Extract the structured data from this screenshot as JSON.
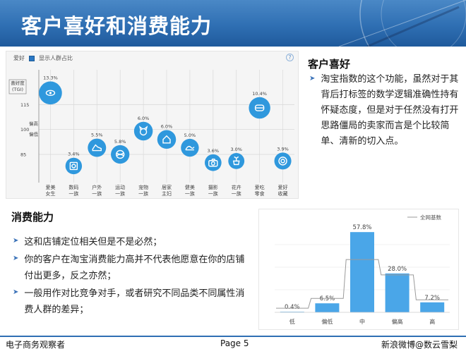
{
  "slide": {
    "title": "客户喜好和消费能力",
    "footer_left": "电子商务观察者",
    "footer_page": "Page 5",
    "footer_right": "新浪微博@数云雪梨"
  },
  "preference": {
    "heading": "客户喜好",
    "paragraph": "淘宝指数的这个功能，虽然对于其背后打标签的数学逻辑准确性持有怀疑态度，但是对于任然没有打开思路僵局的卖家而言是个比较简单、清新的切入点。"
  },
  "spending": {
    "heading": "消费能力",
    "points": [
      "这和店铺定位相关但是不是必然；",
      "你的客户在淘宝消费能力高并不代表他愿意在你的店铺付出更多，反之亦然；",
      "一般用作对比竞争对手，或者研究不同品类不同属性消费人群的差异；"
    ]
  },
  "chart_data": [
    {
      "type": "scatter",
      "header_label": "爱好",
      "checkbox_label": "显示人群占比",
      "ylabel": "喜好度\n(TGI)",
      "yticks": [
        115,
        100,
        85
      ],
      "band_labels": [
        "偏高",
        "偏低"
      ],
      "ylim": [
        68,
        130
      ],
      "grid": true,
      "categories": [
        "爱美\n女生",
        "数码\n一族",
        "户外\n一族",
        "运动\n一族",
        "宠物\n一族",
        "居家\n主妇",
        "健美\n一族",
        "摄影\n一族",
        "花卉\n一族",
        "爱吃\n零食",
        "爱好\n收藏"
      ],
      "tgi": [
        122,
        78,
        89,
        85,
        99,
        94,
        89,
        80,
        81,
        113,
        81
      ],
      "share_labels": [
        "13.3%",
        "3.4%",
        "5.5%",
        "5.8%",
        "6.0%",
        "6.0%",
        "5.0%",
        "3.6%",
        "3.0%",
        "10.4%",
        "3.9%"
      ],
      "share": [
        13.3,
        3.4,
        5.5,
        5.8,
        6.0,
        6.0,
        5.0,
        3.6,
        3.0,
        10.4,
        3.9
      ],
      "icons": [
        "eye-icon",
        "camera-box-icon",
        "shoe-icon",
        "ball-icon",
        "pet-icon",
        "home-icon",
        "fitness-icon",
        "camera-icon",
        "flower-pot-icon",
        "snack-icon",
        "collection-icon"
      ],
      "colors": {
        "bubble": "#2f98dd",
        "grid": "#d9d9d9"
      }
    },
    {
      "type": "bar",
      "legend": "全网基数",
      "legend_position": "top-right",
      "categories": [
        "低",
        "偏低",
        "中",
        "偏高",
        "高"
      ],
      "values": [
        0.4,
        6.5,
        57.8,
        28.0,
        7.2
      ],
      "value_labels": [
        "0.4%",
        "6.5%",
        "57.8%",
        "28.0%",
        "7.2%"
      ],
      "baseline": [
        3,
        10,
        38,
        27,
        9
      ],
      "ylim": [
        0,
        65
      ],
      "colors": {
        "bar": "#4aa6e8",
        "line": "#9a9a9a"
      }
    }
  ]
}
